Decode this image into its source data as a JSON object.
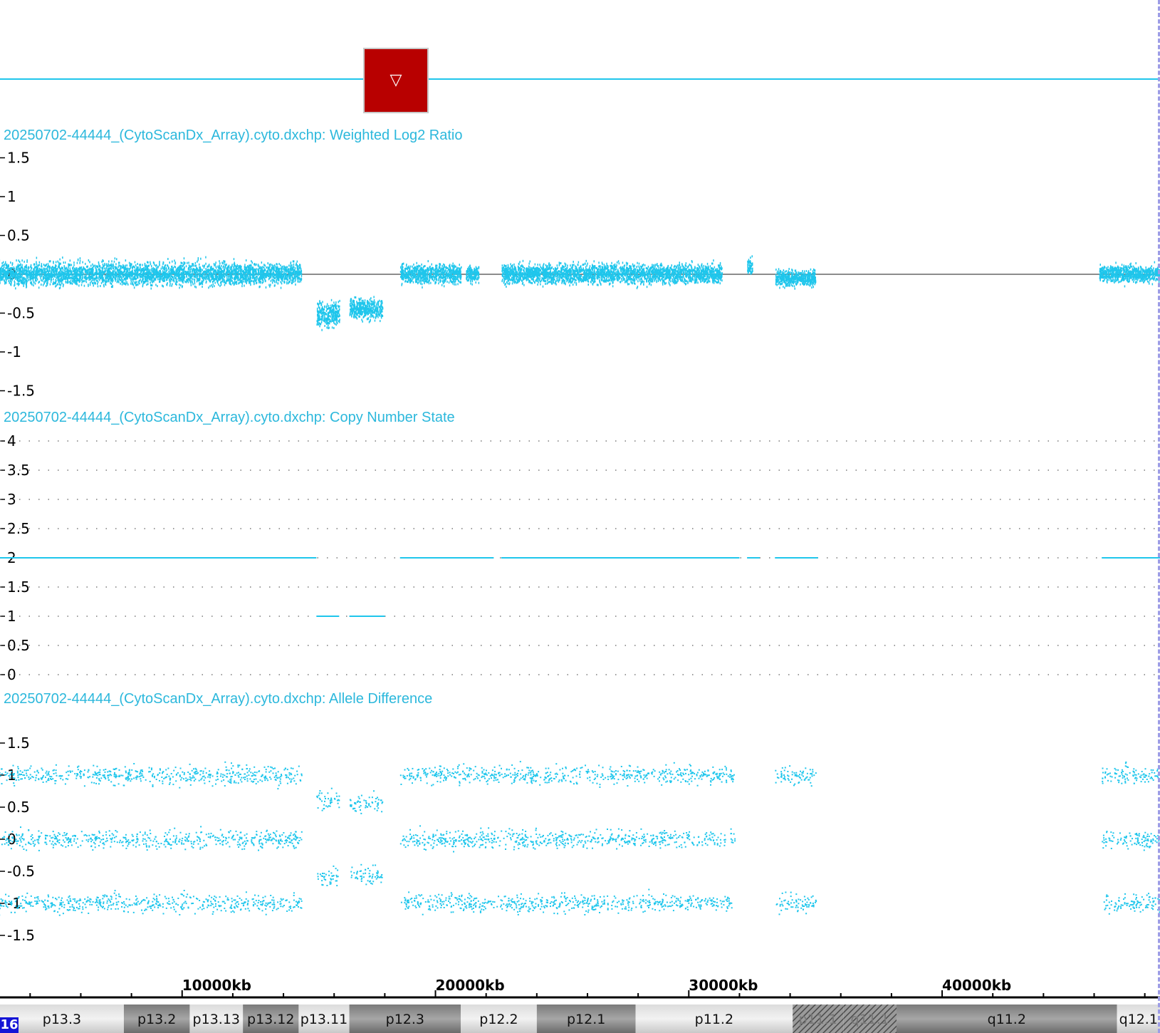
{
  "marker": {
    "icon": "▽"
  },
  "chromosome_badge": "16",
  "tracks": {
    "log2": {
      "title": "20250702-44444_(CytoScanDx_Array).cyto.dxchp: Weighted Log2 Ratio",
      "ticks": [
        "1.5",
        "1",
        "0.5",
        "0",
        "-0.5",
        "-1",
        "-1.5"
      ]
    },
    "cn": {
      "title": "20250702-44444_(CytoScanDx_Array).cyto.dxchp: Copy Number State",
      "ticks": [
        "4",
        "3.5",
        "3",
        "2.5",
        "2",
        "1.5",
        "1",
        "0.5",
        "0"
      ]
    },
    "allele": {
      "title": "20250702-44444_(CytoScanDx_Array).cyto.dxchp: Allele Difference",
      "ticks": [
        "1.5",
        "1",
        "0.5",
        "0",
        "-0.5",
        "-1",
        "-1.5"
      ]
    }
  },
  "ruler": {
    "labels": [
      "10000kb",
      "20000kb",
      "30000kb",
      "40000kb"
    ]
  },
  "ideogram": {
    "bands": [
      {
        "name": "p13.3",
        "start": 0,
        "end": 7700,
        "stain": "light"
      },
      {
        "name": "p13.2",
        "start": 7700,
        "end": 10300,
        "stain": "dark"
      },
      {
        "name": "p13.13",
        "start": 10300,
        "end": 12400,
        "stain": "light"
      },
      {
        "name": "p13.12",
        "start": 12400,
        "end": 14600,
        "stain": "dark"
      },
      {
        "name": "p13.11",
        "start": 14600,
        "end": 16600,
        "stain": "light"
      },
      {
        "name": "p12.3",
        "start": 16600,
        "end": 21000,
        "stain": "dark"
      },
      {
        "name": "p12.2",
        "start": 21000,
        "end": 24000,
        "stain": "light"
      },
      {
        "name": "p12.1",
        "start": 24000,
        "end": 27900,
        "stain": "dark"
      },
      {
        "name": "p11.2",
        "start": 27900,
        "end": 34100,
        "stain": "light"
      },
      {
        "name": "p11.1",
        "start": 34100,
        "end": 36100,
        "stain": "centro"
      },
      {
        "name": "q11.1",
        "start": 36100,
        "end": 38200,
        "stain": "centro"
      },
      {
        "name": "q11.2",
        "start": 38200,
        "end": 46900,
        "stain": "dark"
      },
      {
        "name": "q12.1",
        "start": 46900,
        "end": 48600,
        "stain": "light"
      }
    ]
  },
  "colors": {
    "data": "#1fc6ec",
    "title": "#2cb8dc",
    "baseline": "#666666",
    "marker": "#b80000",
    "cursor": "#9d9de6",
    "badge": "#1515d6"
  },
  "chart_data": [
    {
      "type": "scatter",
      "title": "20250702-44444_(CytoScanDx_Array).cyto.dxchp: Weighted Log2 Ratio",
      "xlabel": "",
      "ylabel": "",
      "xunit": "kb",
      "xlim": [
        0,
        48600
      ],
      "ylim": [
        -1.6,
        1.6
      ],
      "segments": [
        {
          "x": [
            0,
            14700
          ],
          "mean": 0.0,
          "spread": 0.14
        },
        {
          "x": [
            15300,
            16200
          ],
          "mean": -0.52,
          "spread": 0.16
        },
        {
          "x": [
            16600,
            17900
          ],
          "mean": -0.45,
          "spread": 0.13
        },
        {
          "x": [
            18600,
            21000
          ],
          "mean": 0.0,
          "spread": 0.12
        },
        {
          "x": [
            21200,
            21700
          ],
          "mean": 0.0,
          "spread": 0.1
        },
        {
          "x": [
            22600,
            31300
          ],
          "mean": 0.0,
          "spread": 0.12
        },
        {
          "x": [
            32300,
            32500
          ],
          "mean": 0.1,
          "spread": 0.1
        },
        {
          "x": [
            33400,
            35000
          ],
          "mean": -0.05,
          "spread": 0.1
        },
        {
          "x": [
            46200,
            48600
          ],
          "mean": 0.0,
          "spread": 0.1
        }
      ]
    },
    {
      "type": "line",
      "title": "20250702-44444_(CytoScanDx_Array).cyto.dxchp: Copy Number State",
      "xlabel": "",
      "ylabel": "",
      "xunit": "kb",
      "xlim": [
        0,
        48600
      ],
      "ylim": [
        0,
        4
      ],
      "grid": true,
      "segments": [
        {
          "x": [
            0,
            15300
          ],
          "y": 2
        },
        {
          "x": [
            15300,
            16200
          ],
          "y": 1
        },
        {
          "x": [
            16600,
            18000
          ],
          "y": 1
        },
        {
          "x": [
            18600,
            22300
          ],
          "y": 2
        },
        {
          "x": [
            22600,
            32000
          ],
          "y": 2
        },
        {
          "x": [
            32300,
            32800
          ],
          "y": 2
        },
        {
          "x": [
            33400,
            35100
          ],
          "y": 2
        },
        {
          "x": [
            46300,
            48600
          ],
          "y": 2
        }
      ]
    },
    {
      "type": "scatter",
      "title": "20250702-44444_(CytoScanDx_Array).cyto.dxchp: Allele Difference",
      "xlabel": "",
      "ylabel": "",
      "xunit": "kb",
      "xlim": [
        0,
        48600
      ],
      "ylim": [
        -1.8,
        1.8
      ],
      "clusters": [
        {
          "x": [
            0,
            14700
          ],
          "y": [
            1.0,
            0.0,
            -1.0
          ]
        },
        {
          "x": [
            15300,
            16200
          ],
          "y": [
            0.6,
            -0.6
          ]
        },
        {
          "x": [
            16600,
            17900
          ],
          "y": [
            0.55,
            -0.55
          ]
        },
        {
          "x": [
            18600,
            31800
          ],
          "y": [
            1.0,
            0.0,
            -1.0
          ]
        },
        {
          "x": [
            33400,
            35000
          ],
          "y": [
            1.0,
            -1.0
          ]
        },
        {
          "x": [
            46300,
            48600
          ],
          "y": [
            1.0,
            0.0,
            -1.0
          ]
        }
      ]
    }
  ]
}
